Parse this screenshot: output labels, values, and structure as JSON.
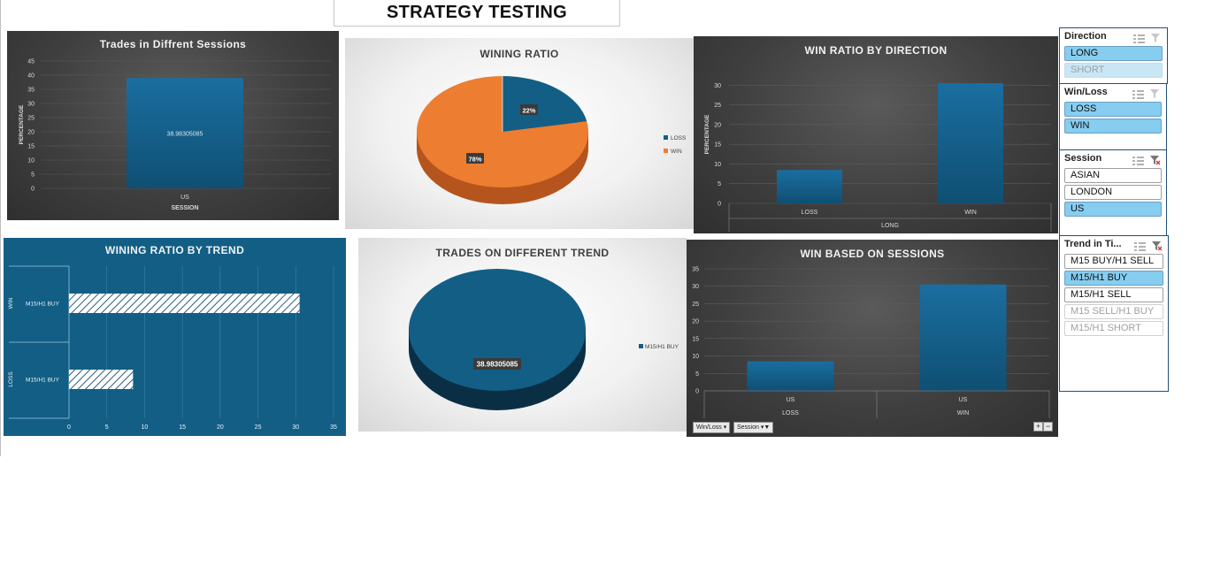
{
  "header": {
    "title": "STRATEGY TESTING"
  },
  "colors": {
    "blue": "#135e85",
    "orange": "#ed7d31",
    "slicer_selected": "#86cdf0"
  },
  "charts": {
    "sessions": {
      "title": "Trades in Diffrent Sessions"
    },
    "wining_ratio": {
      "title": "WINING RATIO"
    },
    "by_direction": {
      "title": "WIN RATIO BY DIRECTION"
    },
    "by_trend": {
      "title": "WINING RATIO BY TREND"
    },
    "trades_trend": {
      "title": "TRADES ON DIFFERENT TREND"
    },
    "win_sessions": {
      "title": "WIN BASED ON SESSIONS",
      "filter_buttons": [
        "Win/Loss",
        "Session"
      ]
    }
  },
  "chart_data": [
    {
      "type": "bar",
      "title": "Trades in Diffrent Sessions",
      "categories": [
        "US"
      ],
      "values": [
        38.98305085
      ],
      "data_labels": [
        "38.98305085"
      ],
      "xlabel": "SESSION",
      "ylabel": "PERCENTAGE",
      "ylim": [
        0,
        45
      ],
      "yticks": [
        0,
        5,
        10,
        15,
        20,
        25,
        30,
        35,
        40,
        45
      ],
      "grid": true
    },
    {
      "type": "pie",
      "title": "WINING RATIO",
      "categories": [
        "LOSS",
        "WIN"
      ],
      "values": [
        22,
        78
      ],
      "data_labels": [
        "22%",
        "78%"
      ],
      "colors": [
        "#135e85",
        "#ed7d31"
      ],
      "legend": "right"
    },
    {
      "type": "bar",
      "title": "WIN RATIO BY DIRECTION",
      "categories": [
        "LOSS",
        "WIN"
      ],
      "values": [
        8.47,
        30.51
      ],
      "group_label": "LONG",
      "ylabel": "PERCENTAGE",
      "ylim": [
        0,
        35
      ],
      "yticks": [
        0,
        5,
        10,
        15,
        20,
        25,
        30
      ],
      "grid": true
    },
    {
      "type": "bar",
      "orientation": "horizontal",
      "title": "WINING RATIO BY TREND",
      "groups": [
        "WIN",
        "LOSS"
      ],
      "categories": [
        "M15/H1 BUY",
        "M15/H1 BUY"
      ],
      "values": [
        30.51,
        8.47
      ],
      "xlim": [
        0,
        35
      ],
      "xticks": [
        0,
        5,
        10,
        15,
        20,
        25,
        30,
        35
      ],
      "grid": true
    },
    {
      "type": "pie",
      "title": "TRADES ON DIFFERENT TREND",
      "categories": [
        "M15/H1 BUY"
      ],
      "values": [
        38.98305085
      ],
      "data_labels": [
        "38.98305085"
      ],
      "legend": "right"
    },
    {
      "type": "bar",
      "title": "WIN BASED ON SESSIONS",
      "categories": [
        "US",
        "US"
      ],
      "groups": [
        "LOSS",
        "WIN"
      ],
      "values": [
        8.47,
        30.51
      ],
      "ylim": [
        0,
        35
      ],
      "yticks": [
        0,
        5,
        10,
        15,
        20,
        25,
        30,
        35
      ],
      "grid": true
    }
  ],
  "slicers": [
    {
      "title": "Direction",
      "items": [
        {
          "label": "LONG",
          "state": "selected"
        },
        {
          "label": "SHORT",
          "state": "dim-selected"
        }
      ]
    },
    {
      "title": "Win/Loss",
      "items": [
        {
          "label": "LOSS",
          "state": "selected"
        },
        {
          "label": "WIN",
          "state": "selected"
        }
      ]
    },
    {
      "title": "Session",
      "items": [
        {
          "label": "ASIAN",
          "state": "normal"
        },
        {
          "label": "LONDON",
          "state": "normal"
        },
        {
          "label": "US",
          "state": "selected"
        }
      ]
    },
    {
      "title": "Trend in Ti...",
      "items": [
        {
          "label": "M15 BUY/H1 SELL",
          "state": "normal"
        },
        {
          "label": "M15/H1 BUY",
          "state": "selected"
        },
        {
          "label": "M15/H1 SELL",
          "state": "normal"
        },
        {
          "label": "M15 SELL/H1 BUY",
          "state": "dim"
        },
        {
          "label": "M15/H1 SHORT",
          "state": "dim"
        }
      ]
    }
  ]
}
